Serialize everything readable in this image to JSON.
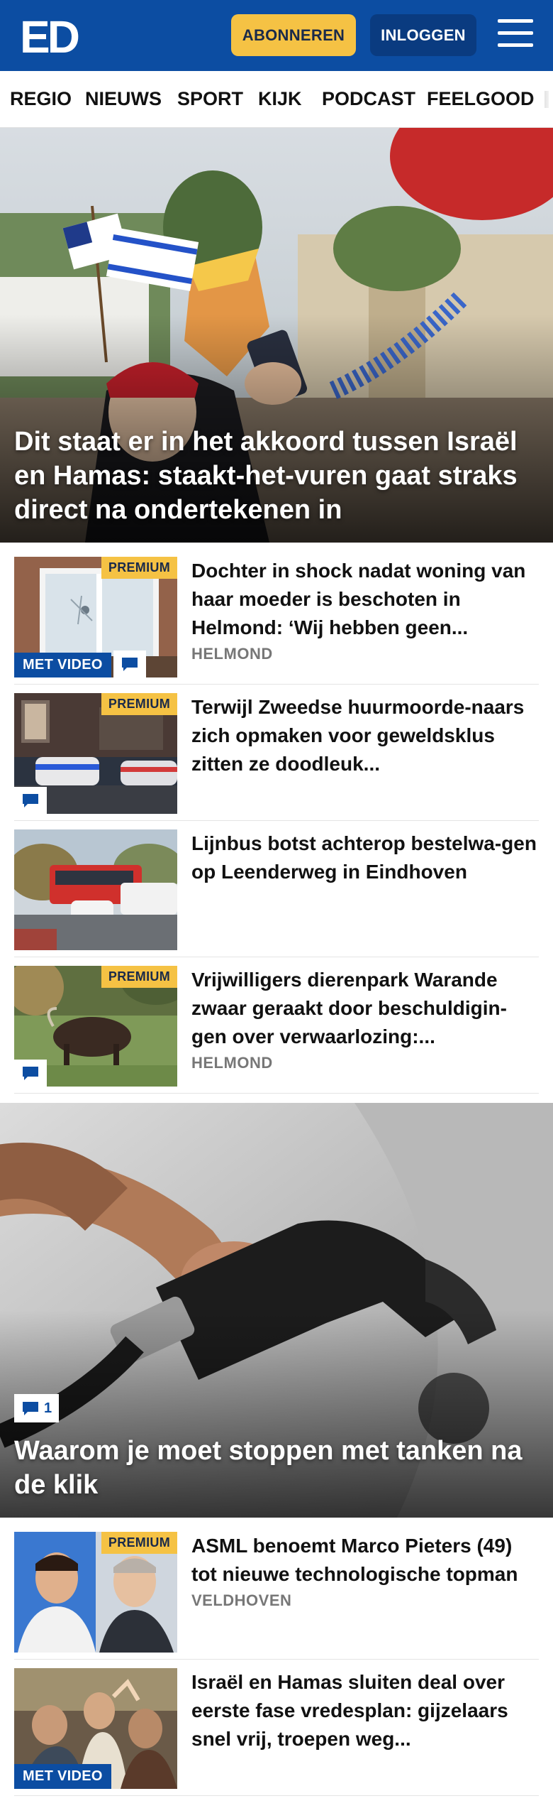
{
  "header": {
    "logo_text": "ED",
    "subscribe_label": "ABONNEREN",
    "login_label": "INLOGGEN"
  },
  "nav": {
    "items": [
      "REGIO",
      "NIEUWS",
      "SPORT",
      "KIJK",
      "PODCAST",
      "FEELGOOD"
    ]
  },
  "hero": {
    "title": "Dit staat er in het akkoord tussen Israël en Hamas: staakt-het-vuren gaat straks direct na ondertekenen in"
  },
  "articles": [
    {
      "title": "Dochter in shock nadat woning van haar moeder is beschoten in Helmond: ‘Wij hebben geen...",
      "location": "HELMOND",
      "premium": true,
      "video": true,
      "comments": true
    },
    {
      "title": "Terwijl Zweedse huurmoorde-naars zich opmaken voor geweldsklus zitten ze doodleuk...",
      "location": "",
      "premium": true,
      "video": false,
      "comments": true
    },
    {
      "title": "Lijnbus botst achterop bestelwa-gen op Leenderweg in Eindhoven",
      "location": "",
      "premium": false,
      "video": false,
      "comments": false
    },
    {
      "title": "Vrijwilligers dierenpark Warande zwaar geraakt door beschuldigin-gen over verwaarlozing:...",
      "location": "HELMOND",
      "premium": true,
      "video": false,
      "comments": true
    }
  ],
  "hero2": {
    "title": "Waarom je moet stoppen met tanken na de klik",
    "comment_count": "1"
  },
  "articles2": [
    {
      "title": "ASML benoemt Marco Pieters (49) tot nieuwe technologische topman",
      "location": "VELDHOVEN",
      "premium": true,
      "video": false
    },
    {
      "title": "Israël en Hamas sluiten deal over eerste fase vredesplan: gijzelaars snel vrij, troepen weg...",
      "location": "",
      "premium": false,
      "video": true
    }
  ],
  "badges": {
    "premium_label": "PREMIUM",
    "video_label": "MET VIDEO"
  },
  "colors": {
    "brand_blue": "#0c4da2",
    "premium_yellow": "#f5c244"
  }
}
